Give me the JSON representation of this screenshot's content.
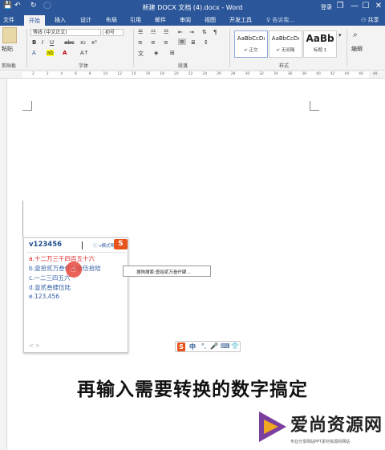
{
  "window": {
    "title": "新建 DOCX 文档 (4).docx - Word",
    "login": "登录",
    "controls": {
      "restore": "❐",
      "minimize": "—",
      "maximize": "☐",
      "close": "✕"
    }
  },
  "quick_access": {
    "save_icon": "💾",
    "undo_icon": "↶",
    "redo_icon": "↻",
    "touch_icon": "◯"
  },
  "tabs": [
    {
      "label": "文件"
    },
    {
      "label": "开始"
    },
    {
      "label": "插入"
    },
    {
      "label": "设计"
    },
    {
      "label": "布局"
    },
    {
      "label": "引用"
    },
    {
      "label": "邮件"
    },
    {
      "label": "审阅"
    },
    {
      "label": "视图"
    },
    {
      "label": "开发工具"
    }
  ],
  "tell_me": "♀ 告诉我...",
  "share": "⚇ 共享",
  "ribbon": {
    "paste_label": "粘贴",
    "clipboard_label": "剪贴板",
    "font_name": "等线 (中文正文)",
    "font_size": "初号",
    "font_label": "字体",
    "paragraph_label": "段落",
    "styles_label": "样式",
    "editing_label": "编辑",
    "styles": [
      {
        "sample": "AaBbCcDı",
        "name": "↵ 正文"
      },
      {
        "sample": "AaBbCcDı",
        "name": "↵ 无间隔"
      },
      {
        "sample": "AaBb",
        "name": "标题 1"
      }
    ]
  },
  "ruler_ticks": [
    "2",
    "2",
    "4",
    "6",
    "8",
    "10",
    "12",
    "14",
    "16",
    "18",
    "20",
    "22",
    "24",
    "26",
    "28",
    "30",
    "32",
    "34",
    "36",
    "38",
    "40",
    "42",
    "44",
    "46",
    "48"
  ],
  "ime": {
    "input": "v123456",
    "tip": "ⓘ v模式帮助",
    "candidates": [
      "a.十二万三千四百五十六",
      "b.壹拾贰万叁仟肆佰伍拾陆",
      "c.一二三四五六",
      "d.壹贰叁肆伍陆",
      "e.123,456"
    ],
    "nav": "< >"
  },
  "tooltip": "搜狗搜索:壹拾贰万叁仟肆…",
  "ime_toolbar": [
    "S",
    "中",
    "°,",
    "🎤",
    "⌨",
    "👕"
  ],
  "subtitle": "再输入需要转换的数字搞定",
  "watermark": {
    "title": "爱尚资源网",
    "sub": "专业分享网站PPT素材资源的网站"
  }
}
